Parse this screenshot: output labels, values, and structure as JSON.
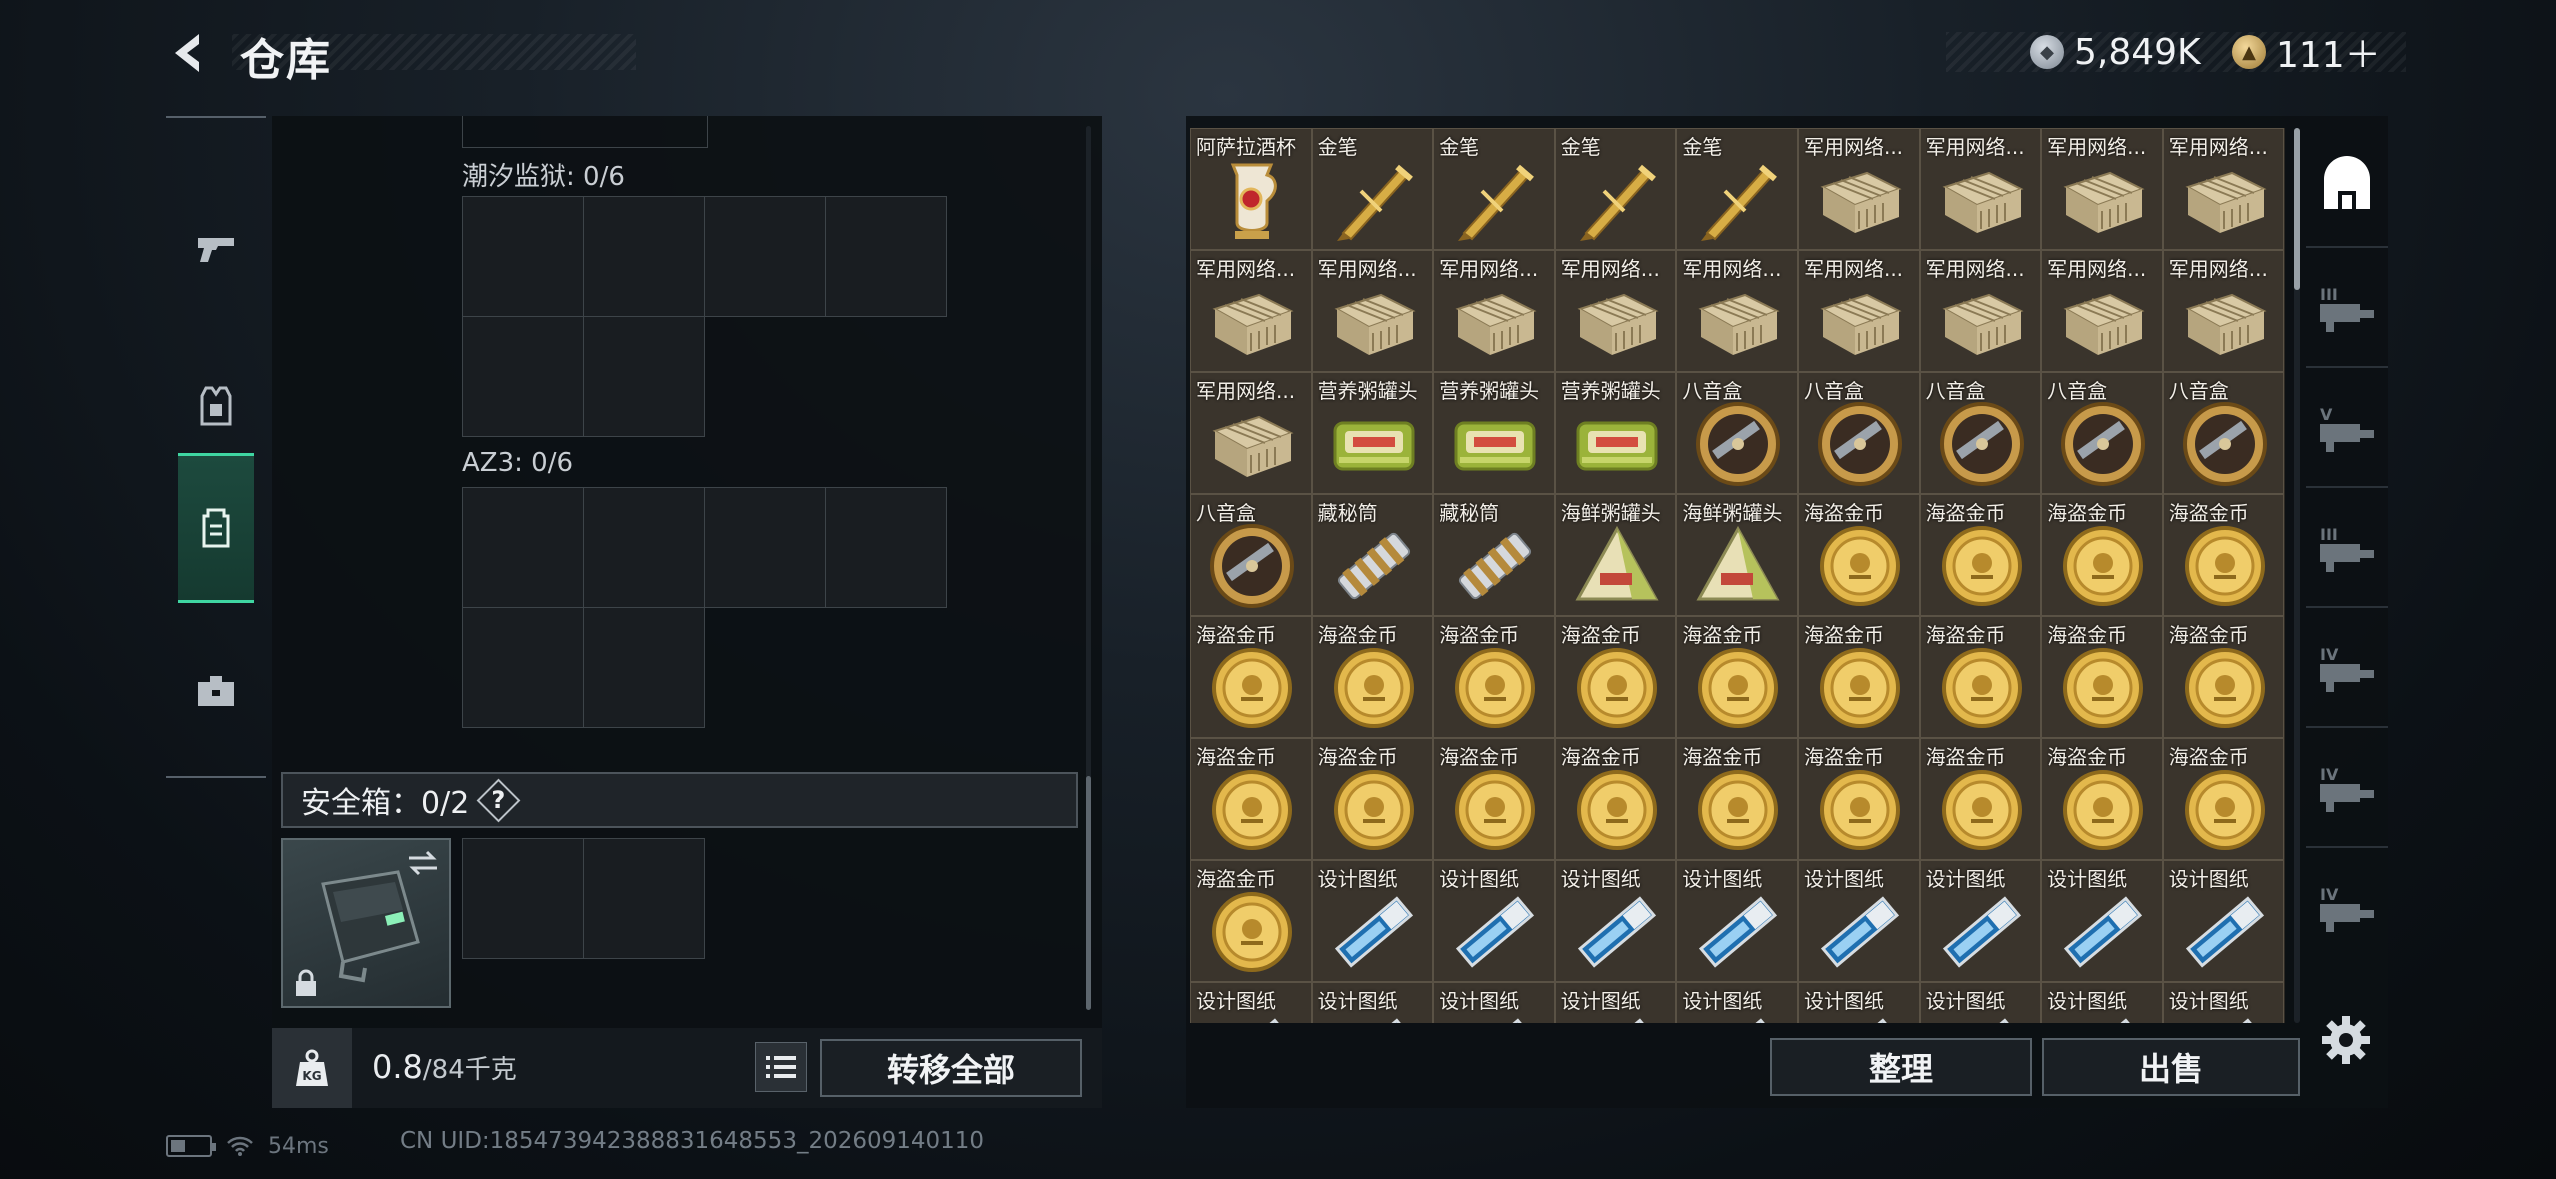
{
  "header": {
    "title": "仓库",
    "currency": [
      {
        "icon": "silver-coin-icon",
        "value": "5,849K"
      },
      {
        "icon": "gold-coin-icon",
        "value": "111＋"
      }
    ],
    "version_hint": ""
  },
  "left_nav": [
    {
      "name": "pistol-icon",
      "active": false
    },
    {
      "name": "armor-vest-icon",
      "active": false
    },
    {
      "name": "backpack-icon",
      "active": true
    },
    {
      "name": "toolbox-icon",
      "active": false
    }
  ],
  "containers": [
    {
      "label": "潮汐监狱: 0/6"
    },
    {
      "label": "AZ3: 0/6"
    }
  ],
  "safe_box": {
    "label": "安全箱：0/2",
    "help": "?"
  },
  "weight": {
    "current": "0.8",
    "max": "/84千克",
    "icon_label": "KG"
  },
  "buttons": {
    "transfer_all": "转移全部",
    "sort": "整理",
    "sell": "出售"
  },
  "status": {
    "ping": "54ms",
    "uid": "CN UID:185473942388831648553_202609140110"
  },
  "stash": [
    {
      "name": "阿萨拉酒杯",
      "art": "cup"
    },
    {
      "name": "金笔",
      "art": "pen"
    },
    {
      "name": "金笔",
      "art": "pen"
    },
    {
      "name": "金笔",
      "art": "pen"
    },
    {
      "name": "金笔",
      "art": "pen"
    },
    {
      "name": "军用网络...",
      "art": "router"
    },
    {
      "name": "军用网络...",
      "art": "router"
    },
    {
      "name": "军用网络...",
      "art": "router"
    },
    {
      "name": "军用网络...",
      "art": "router"
    },
    {
      "name": "军用网络...",
      "art": "router"
    },
    {
      "name": "军用网络...",
      "art": "router"
    },
    {
      "name": "军用网络...",
      "art": "router"
    },
    {
      "name": "军用网络...",
      "art": "router"
    },
    {
      "name": "军用网络...",
      "art": "router"
    },
    {
      "name": "军用网络...",
      "art": "router"
    },
    {
      "name": "军用网络...",
      "art": "router"
    },
    {
      "name": "军用网络...",
      "art": "router"
    },
    {
      "name": "军用网络...",
      "art": "router"
    },
    {
      "name": "军用网络...",
      "art": "router"
    },
    {
      "name": "营养粥罐头",
      "art": "tin"
    },
    {
      "name": "营养粥罐头",
      "art": "tin"
    },
    {
      "name": "营养粥罐头",
      "art": "tin"
    },
    {
      "name": "八音盒",
      "art": "musicbox"
    },
    {
      "name": "八音盒",
      "art": "musicbox"
    },
    {
      "name": "八音盒",
      "art": "musicbox"
    },
    {
      "name": "八音盒",
      "art": "musicbox"
    },
    {
      "name": "八音盒",
      "art": "musicbox"
    },
    {
      "name": "八音盒",
      "art": "musicbox"
    },
    {
      "name": "藏秘筒",
      "art": "cryptex"
    },
    {
      "name": "藏秘筒",
      "art": "cryptex"
    },
    {
      "name": "海鲜粥罐头",
      "art": "pyramid"
    },
    {
      "name": "海鲜粥罐头",
      "art": "pyramid"
    },
    {
      "name": "海盗金币",
      "art": "coin"
    },
    {
      "name": "海盗金币",
      "art": "coin"
    },
    {
      "name": "海盗金币",
      "art": "coin"
    },
    {
      "name": "海盗金币",
      "art": "coin"
    },
    {
      "name": "海盗金币",
      "art": "coin"
    },
    {
      "name": "海盗金币",
      "art": "coin"
    },
    {
      "name": "海盗金币",
      "art": "coin"
    },
    {
      "name": "海盗金币",
      "art": "coin"
    },
    {
      "name": "海盗金币",
      "art": "coin"
    },
    {
      "name": "海盗金币",
      "art": "coin"
    },
    {
      "name": "海盗金币",
      "art": "coin"
    },
    {
      "name": "海盗金币",
      "art": "coin"
    },
    {
      "name": "海盗金币",
      "art": "coin"
    },
    {
      "name": "海盗金币",
      "art": "coin"
    },
    {
      "name": "海盗金币",
      "art": "coin"
    },
    {
      "name": "海盗金币",
      "art": "coin"
    },
    {
      "name": "海盗金币",
      "art": "coin"
    },
    {
      "name": "海盗金币",
      "art": "coin"
    },
    {
      "name": "海盗金币",
      "art": "coin"
    },
    {
      "name": "海盗金币",
      "art": "coin"
    },
    {
      "name": "海盗金币",
      "art": "coin"
    },
    {
      "name": "海盗金币",
      "art": "coin"
    },
    {
      "name": "海盗金币",
      "art": "coin"
    },
    {
      "name": "设计图纸",
      "art": "blueprint"
    },
    {
      "name": "设计图纸",
      "art": "blueprint"
    },
    {
      "name": "设计图纸",
      "art": "blueprint"
    },
    {
      "name": "设计图纸",
      "art": "blueprint"
    },
    {
      "name": "设计图纸",
      "art": "blueprint"
    },
    {
      "name": "设计图纸",
      "art": "blueprint"
    },
    {
      "name": "设计图纸",
      "art": "blueprint"
    },
    {
      "name": "设计图纸",
      "art": "blueprint"
    },
    {
      "name": "设计图纸",
      "art": "blueprint"
    },
    {
      "name": "设计图纸",
      "art": "blueprint"
    },
    {
      "name": "设计图纸",
      "art": "blueprint"
    },
    {
      "name": "设计图纸",
      "art": "blueprint"
    },
    {
      "name": "设计图纸",
      "art": "blueprint"
    },
    {
      "name": "设计图纸",
      "art": "blueprint"
    },
    {
      "name": "设计图纸",
      "art": "blueprint"
    },
    {
      "name": "设计图纸",
      "art": "blueprint"
    },
    {
      "name": "设计图纸",
      "art": "blueprint"
    }
  ],
  "right_nav": [
    {
      "name": "stash-home-icon",
      "label": "",
      "active": true
    },
    {
      "name": "stash-tab-iii-icon",
      "label": "III",
      "active": false
    },
    {
      "name": "stash-tab-v-icon",
      "label": "V",
      "active": false
    },
    {
      "name": "stash-tab-iii-b-icon",
      "label": "III",
      "active": false
    },
    {
      "name": "stash-tab-iv-icon",
      "label": "IV",
      "active": false
    },
    {
      "name": "stash-tab-iv-b-icon",
      "label": "IV",
      "active": false
    },
    {
      "name": "stash-tab-iv-c-icon",
      "label": "IV",
      "active": false
    }
  ],
  "colors": {
    "accent_green": "#3fd6a2",
    "stash_cell": "#3a342c",
    "panel": "#0c1014"
  }
}
